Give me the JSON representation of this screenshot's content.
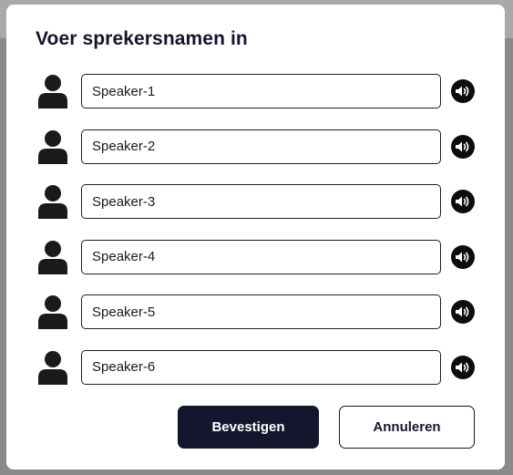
{
  "dialog": {
    "title": "Voer sprekersnamen in"
  },
  "speakers": [
    {
      "value": "Speaker-1"
    },
    {
      "value": "Speaker-2"
    },
    {
      "value": "Speaker-3"
    },
    {
      "value": "Speaker-4"
    },
    {
      "value": "Speaker-5"
    },
    {
      "value": "Speaker-6"
    }
  ],
  "icons": {
    "person": "person-icon",
    "speaker": "volume-icon"
  },
  "buttons": {
    "confirm_label": "Bevestigen",
    "cancel_label": "Annuleren"
  },
  "colors": {
    "primary": "#14162e",
    "backdrop": "#8a8a8a"
  }
}
